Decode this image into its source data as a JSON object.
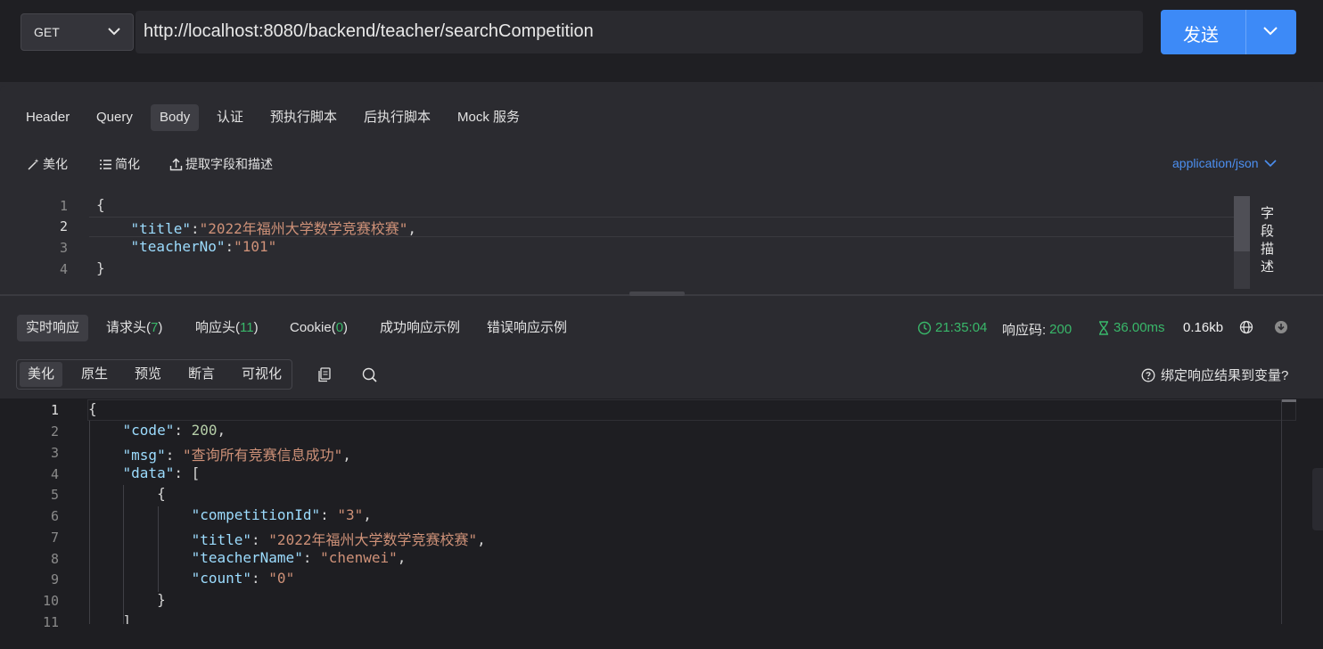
{
  "request": {
    "method": "GET",
    "url": "http://localhost:8080/backend/teacher/searchCompetition",
    "send_label": "发送"
  },
  "request_tabs": [
    {
      "label": "Header",
      "active": false
    },
    {
      "label": "Query",
      "active": false
    },
    {
      "label": "Body",
      "active": true
    },
    {
      "label": "认证",
      "active": false
    },
    {
      "label": "预执行脚本",
      "active": false
    },
    {
      "label": "后执行脚本",
      "active": false
    },
    {
      "label": "Mock 服务",
      "active": false
    }
  ],
  "body_tools": {
    "beautify": "美化",
    "simplify": "简化",
    "extract": "提取字段和描述",
    "content_type": "application/json"
  },
  "request_body": {
    "line_numbers": [
      "1",
      "2",
      "3",
      "4"
    ],
    "open_brace": "{",
    "title_key": "\"title\"",
    "title_value": "\"2022年福州大学数学竞赛校赛\"",
    "teacher_key": "\"teacherNo\"",
    "teacher_value": "\"101\"",
    "close_brace": "}",
    "field_desc_label": "字段描述"
  },
  "response_tabs": {
    "realtime": "实时响应",
    "req_headers": "请求头(",
    "req_headers_count": "7",
    "resp_headers": "响应头(",
    "resp_headers_count": "11",
    "cookie": "Cookie(",
    "cookie_count": "0",
    "close_paren": ")",
    "success_example": "成功响应示例",
    "error_example": "错误响应示例"
  },
  "response_stats": {
    "time": "21:35:04",
    "status_label": "响应码:",
    "status_code": "200",
    "duration": "36.00ms",
    "size": "0.16kb"
  },
  "view_tabs": [
    {
      "label": "美化",
      "active": true
    },
    {
      "label": "原生",
      "active": false
    },
    {
      "label": "预览",
      "active": false
    },
    {
      "label": "断言",
      "active": false
    },
    {
      "label": "可视化",
      "active": false
    }
  ],
  "bind_variable": "绑定响应结果到变量?",
  "response_body": {
    "line_numbers": [
      "1",
      "2",
      "3",
      "4",
      "5",
      "6",
      "7",
      "8",
      "9",
      "10",
      "11"
    ],
    "code_key": "\"code\"",
    "code_value": "200",
    "msg_key": "\"msg\"",
    "msg_value": "\"查询所有竞赛信息成功\"",
    "data_key": "\"data\"",
    "competitionId_key": "\"competitionId\"",
    "competitionId_value": "\"3\"",
    "title_key": "\"title\"",
    "title_value": "\"2022年福州大学数学竞赛校赛\"",
    "teacherName_key": "\"teacherName\"",
    "teacherName_value": "\"chenwei\"",
    "count_key": "\"count\"",
    "count_value": "\"0\""
  },
  "colors": {
    "accent": "#3d8af7",
    "success": "#39b86a",
    "json_key": "#9cdcfe",
    "json_string": "#ce9178",
    "json_number": "#b5cea8"
  }
}
